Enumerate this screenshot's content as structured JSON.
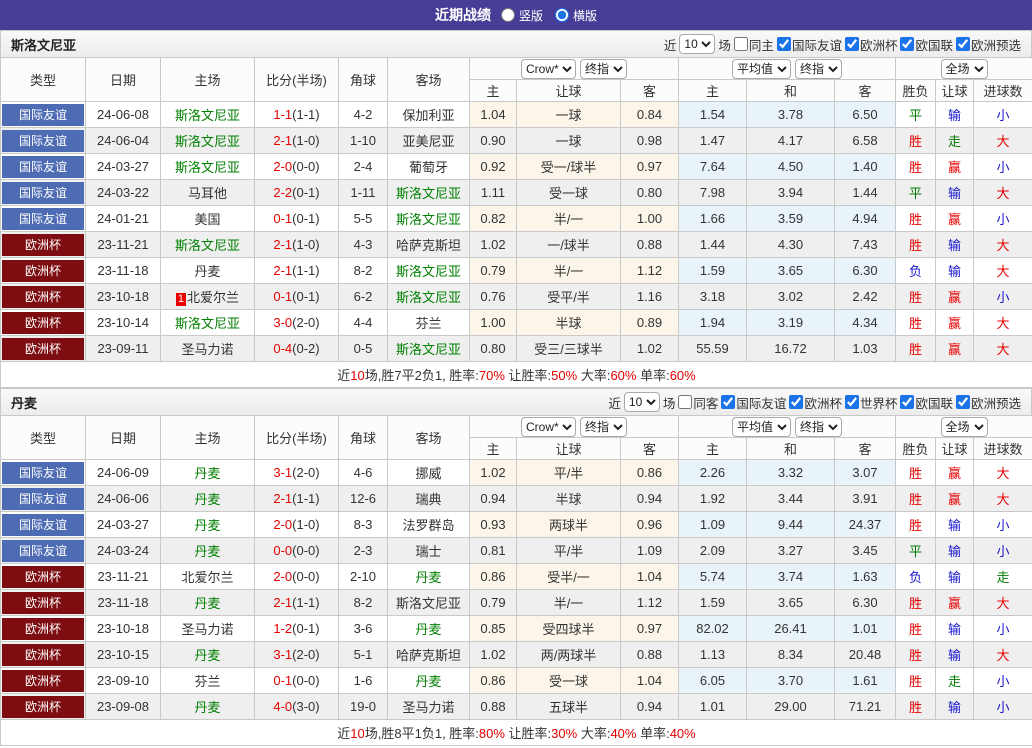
{
  "title_bar": {
    "title": "近期战绩",
    "orientation_options": [
      {
        "label": "竖版",
        "checked": false
      },
      {
        "label": "横版",
        "checked": true
      }
    ]
  },
  "table_head": {
    "left_columns": [
      "类型",
      "日期",
      "主场",
      "比分(半场)",
      "角球",
      "客场"
    ],
    "group1_selects": [
      "Crow*",
      "终指"
    ],
    "group2_selects": [
      "平均值",
      "终指"
    ],
    "group3_selects": [
      "全场"
    ],
    "sub_columns": [
      "主",
      "让球",
      "客",
      "主",
      "和",
      "客",
      "胜负",
      "让球",
      "进球数"
    ]
  },
  "league_colors": {
    "国际友谊": "#4e6cb3",
    "欧洲杯": "#7d0d10"
  },
  "result_colors": {
    "red": "#e60000",
    "blue": "#1515cc",
    "green": "#007a00"
  },
  "score_color": "#e60000",
  "team_highlight_color": "#008000",
  "sections": [
    {
      "team": "斯洛文尼亚",
      "filter": {
        "prefix": "近",
        "count": "10",
        "suffix": "场",
        "same": {
          "label": "同主",
          "checked": false
        },
        "leagues": [
          {
            "label": "国际友谊",
            "checked": true
          },
          {
            "label": "欧洲杯",
            "checked": true
          },
          {
            "label": "欧国联",
            "checked": true
          },
          {
            "label": "欧洲预选",
            "checked": true
          }
        ]
      },
      "rows": [
        {
          "league": "国际友谊",
          "date": "24-06-08",
          "home": "斯洛文尼亚",
          "home_highlight": true,
          "home_badge": "",
          "score": "1-1",
          "half": "(1-1)",
          "corners": "4-2",
          "away": "保加利亚",
          "away_highlight": false,
          "odds": [
            "1.04",
            "一球",
            "0.84",
            "1.54",
            "3.78",
            "6.50"
          ],
          "results": [
            [
              "平",
              "green"
            ],
            [
              "输",
              "blue"
            ],
            [
              "小",
              "blue"
            ]
          ]
        },
        {
          "league": "国际友谊",
          "date": "24-06-04",
          "home": "斯洛文尼亚",
          "home_highlight": true,
          "home_badge": "",
          "score": "2-1",
          "half": "(1-0)",
          "corners": "1-10",
          "away": "亚美尼亚",
          "away_highlight": false,
          "odds": [
            "0.90",
            "一球",
            "0.98",
            "1.47",
            "4.17",
            "6.58"
          ],
          "results": [
            [
              "胜",
              "red"
            ],
            [
              "走",
              "green"
            ],
            [
              "大",
              "red"
            ]
          ]
        },
        {
          "league": "国际友谊",
          "date": "24-03-27",
          "home": "斯洛文尼亚",
          "home_highlight": true,
          "home_badge": "",
          "score": "2-0",
          "half": "(0-0)",
          "corners": "2-4",
          "away": "葡萄牙",
          "away_highlight": false,
          "odds": [
            "0.92",
            "受一/球半",
            "0.97",
            "7.64",
            "4.50",
            "1.40"
          ],
          "results": [
            [
              "胜",
              "red"
            ],
            [
              "赢",
              "red"
            ],
            [
              "小",
              "blue"
            ]
          ]
        },
        {
          "league": "国际友谊",
          "date": "24-03-22",
          "home": "马耳他",
          "home_highlight": false,
          "home_badge": "",
          "score": "2-2",
          "half": "(0-1)",
          "corners": "1-11",
          "away": "斯洛文尼亚",
          "away_highlight": true,
          "odds": [
            "1.11",
            "受一球",
            "0.80",
            "7.98",
            "3.94",
            "1.44"
          ],
          "results": [
            [
              "平",
              "green"
            ],
            [
              "输",
              "blue"
            ],
            [
              "大",
              "red"
            ]
          ]
        },
        {
          "league": "国际友谊",
          "date": "24-01-21",
          "home": "美国",
          "home_highlight": false,
          "home_badge": "",
          "score": "0-1",
          "half": "(0-1)",
          "corners": "5-5",
          "away": "斯洛文尼亚",
          "away_highlight": true,
          "odds": [
            "0.82",
            "半/一",
            "1.00",
            "1.66",
            "3.59",
            "4.94"
          ],
          "results": [
            [
              "胜",
              "red"
            ],
            [
              "赢",
              "red"
            ],
            [
              "小",
              "blue"
            ]
          ]
        },
        {
          "league": "欧洲杯",
          "date": "23-11-21",
          "home": "斯洛文尼亚",
          "home_highlight": true,
          "home_badge": "",
          "score": "2-1",
          "half": "(1-0)",
          "corners": "4-3",
          "away": "哈萨克斯坦",
          "away_highlight": false,
          "odds": [
            "1.02",
            "一/球半",
            "0.88",
            "1.44",
            "4.30",
            "7.43"
          ],
          "results": [
            [
              "胜",
              "red"
            ],
            [
              "输",
              "blue"
            ],
            [
              "大",
              "red"
            ]
          ]
        },
        {
          "league": "欧洲杯",
          "date": "23-11-18",
          "home": "丹麦",
          "home_highlight": false,
          "home_badge": "",
          "score": "2-1",
          "half": "(1-1)",
          "corners": "8-2",
          "away": "斯洛文尼亚",
          "away_highlight": true,
          "odds": [
            "0.79",
            "半/一",
            "1.12",
            "1.59",
            "3.65",
            "6.30"
          ],
          "results": [
            [
              "负",
              "blue"
            ],
            [
              "输",
              "blue"
            ],
            [
              "大",
              "red"
            ]
          ]
        },
        {
          "league": "欧洲杯",
          "date": "23-10-18",
          "home": "北爱尔兰",
          "home_highlight": false,
          "home_badge": "1",
          "score": "0-1",
          "half": "(0-1)",
          "corners": "6-2",
          "away": "斯洛文尼亚",
          "away_highlight": true,
          "odds": [
            "0.76",
            "受平/半",
            "1.16",
            "3.18",
            "3.02",
            "2.42"
          ],
          "results": [
            [
              "胜",
              "red"
            ],
            [
              "赢",
              "red"
            ],
            [
              "小",
              "blue"
            ]
          ]
        },
        {
          "league": "欧洲杯",
          "date": "23-10-14",
          "home": "斯洛文尼亚",
          "home_highlight": true,
          "home_badge": "",
          "score": "3-0",
          "half": "(2-0)",
          "corners": "4-4",
          "away": "芬兰",
          "away_highlight": false,
          "odds": [
            "1.00",
            "半球",
            "0.89",
            "1.94",
            "3.19",
            "4.34"
          ],
          "results": [
            [
              "胜",
              "red"
            ],
            [
              "赢",
              "red"
            ],
            [
              "大",
              "red"
            ]
          ]
        },
        {
          "league": "欧洲杯",
          "date": "23-09-11",
          "home": "圣马力诺",
          "home_highlight": false,
          "home_badge": "",
          "score": "0-4",
          "half": "(0-2)",
          "corners": "0-5",
          "away": "斯洛文尼亚",
          "away_highlight": true,
          "odds": [
            "0.80",
            "受三/三球半",
            "1.02",
            "55.59",
            "16.72",
            "1.03"
          ],
          "results": [
            [
              "胜",
              "red"
            ],
            [
              "赢",
              "red"
            ],
            [
              "大",
              "red"
            ]
          ]
        }
      ],
      "summary": [
        [
          "近",
          false
        ],
        [
          "10",
          true
        ],
        [
          "场,胜7平2负1, 胜率:",
          false
        ],
        [
          "70%",
          true
        ],
        [
          " 让胜率:",
          false
        ],
        [
          "50%",
          true
        ],
        [
          " 大率:",
          false
        ],
        [
          "60%",
          true
        ],
        [
          " 单率:",
          false
        ],
        [
          "60%",
          true
        ]
      ]
    },
    {
      "team": "丹麦",
      "filter": {
        "prefix": "近",
        "count": "10",
        "suffix": "场",
        "same": {
          "label": "同客",
          "checked": false
        },
        "leagues": [
          {
            "label": "国际友谊",
            "checked": true
          },
          {
            "label": "欧洲杯",
            "checked": true
          },
          {
            "label": "世界杯",
            "checked": true
          },
          {
            "label": "欧国联",
            "checked": true
          },
          {
            "label": "欧洲预选",
            "checked": true
          }
        ]
      },
      "rows": [
        {
          "league": "国际友谊",
          "date": "24-06-09",
          "home": "丹麦",
          "home_highlight": true,
          "home_badge": "",
          "score": "3-1",
          "half": "(2-0)",
          "corners": "4-6",
          "away": "挪威",
          "away_highlight": false,
          "odds": [
            "1.02",
            "平/半",
            "0.86",
            "2.26",
            "3.32",
            "3.07"
          ],
          "results": [
            [
              "胜",
              "red"
            ],
            [
              "赢",
              "red"
            ],
            [
              "大",
              "red"
            ]
          ]
        },
        {
          "league": "国际友谊",
          "date": "24-06-06",
          "home": "丹麦",
          "home_highlight": true,
          "home_badge": "",
          "score": "2-1",
          "half": "(1-1)",
          "corners": "12-6",
          "away": "瑞典",
          "away_highlight": false,
          "odds": [
            "0.94",
            "半球",
            "0.94",
            "1.92",
            "3.44",
            "3.91"
          ],
          "results": [
            [
              "胜",
              "red"
            ],
            [
              "赢",
              "red"
            ],
            [
              "大",
              "red"
            ]
          ]
        },
        {
          "league": "国际友谊",
          "date": "24-03-27",
          "home": "丹麦",
          "home_highlight": true,
          "home_badge": "",
          "score": "2-0",
          "half": "(1-0)",
          "corners": "8-3",
          "away": "法罗群岛",
          "away_highlight": false,
          "odds": [
            "0.93",
            "两球半",
            "0.96",
            "1.09",
            "9.44",
            "24.37"
          ],
          "results": [
            [
              "胜",
              "red"
            ],
            [
              "输",
              "blue"
            ],
            [
              "小",
              "blue"
            ]
          ]
        },
        {
          "league": "国际友谊",
          "date": "24-03-24",
          "home": "丹麦",
          "home_highlight": true,
          "home_badge": "",
          "score": "0-0",
          "half": "(0-0)",
          "corners": "2-3",
          "away": "瑞士",
          "away_highlight": false,
          "odds": [
            "0.81",
            "平/半",
            "1.09",
            "2.09",
            "3.27",
            "3.45"
          ],
          "results": [
            [
              "平",
              "green"
            ],
            [
              "输",
              "blue"
            ],
            [
              "小",
              "blue"
            ]
          ]
        },
        {
          "league": "欧洲杯",
          "date": "23-11-21",
          "home": "北爱尔兰",
          "home_highlight": false,
          "home_badge": "",
          "score": "2-0",
          "half": "(0-0)",
          "corners": "2-10",
          "away": "丹麦",
          "away_highlight": true,
          "odds": [
            "0.86",
            "受半/一",
            "1.04",
            "5.74",
            "3.74",
            "1.63"
          ],
          "results": [
            [
              "负",
              "blue"
            ],
            [
              "输",
              "blue"
            ],
            [
              "走",
              "green"
            ]
          ]
        },
        {
          "league": "欧洲杯",
          "date": "23-11-18",
          "home": "丹麦",
          "home_highlight": true,
          "home_badge": "",
          "score": "2-1",
          "half": "(1-1)",
          "corners": "8-2",
          "away": "斯洛文尼亚",
          "away_highlight": false,
          "odds": [
            "0.79",
            "半/一",
            "1.12",
            "1.59",
            "3.65",
            "6.30"
          ],
          "results": [
            [
              "胜",
              "red"
            ],
            [
              "赢",
              "red"
            ],
            [
              "大",
              "red"
            ]
          ]
        },
        {
          "league": "欧洲杯",
          "date": "23-10-18",
          "home": "圣马力诺",
          "home_highlight": false,
          "home_badge": "",
          "score": "1-2",
          "half": "(0-1)",
          "corners": "3-6",
          "away": "丹麦",
          "away_highlight": true,
          "odds": [
            "0.85",
            "受四球半",
            "0.97",
            "82.02",
            "26.41",
            "1.01"
          ],
          "results": [
            [
              "胜",
              "red"
            ],
            [
              "输",
              "blue"
            ],
            [
              "小",
              "blue"
            ]
          ]
        },
        {
          "league": "欧洲杯",
          "date": "23-10-15",
          "home": "丹麦",
          "home_highlight": true,
          "home_badge": "",
          "score": "3-1",
          "half": "(2-0)",
          "corners": "5-1",
          "away": "哈萨克斯坦",
          "away_highlight": false,
          "odds": [
            "1.02",
            "两/两球半",
            "0.88",
            "1.13",
            "8.34",
            "20.48"
          ],
          "results": [
            [
              "胜",
              "red"
            ],
            [
              "输",
              "blue"
            ],
            [
              "大",
              "red"
            ]
          ]
        },
        {
          "league": "欧洲杯",
          "date": "23-09-10",
          "home": "芬兰",
          "home_highlight": false,
          "home_badge": "",
          "score": "0-1",
          "half": "(0-0)",
          "corners": "1-6",
          "away": "丹麦",
          "away_highlight": true,
          "odds": [
            "0.86",
            "受一球",
            "1.04",
            "6.05",
            "3.70",
            "1.61"
          ],
          "results": [
            [
              "胜",
              "red"
            ],
            [
              "走",
              "green"
            ],
            [
              "小",
              "blue"
            ]
          ]
        },
        {
          "league": "欧洲杯",
          "date": "23-09-08",
          "home": "丹麦",
          "home_highlight": true,
          "home_badge": "",
          "score": "4-0",
          "half": "(3-0)",
          "corners": "19-0",
          "away": "圣马力诺",
          "away_highlight": false,
          "odds": [
            "0.88",
            "五球半",
            "0.94",
            "1.01",
            "29.00",
            "71.21"
          ],
          "results": [
            [
              "胜",
              "red"
            ],
            [
              "输",
              "blue"
            ],
            [
              "小",
              "blue"
            ]
          ]
        }
      ],
      "summary": [
        [
          "近",
          false
        ],
        [
          "10",
          true
        ],
        [
          "场,胜8平1负1, 胜率:",
          false
        ],
        [
          "80%",
          true
        ],
        [
          " 让胜率:",
          false
        ],
        [
          "30%",
          true
        ],
        [
          " 大率:",
          false
        ],
        [
          "40%",
          true
        ],
        [
          " 单率:",
          false
        ],
        [
          "40%",
          true
        ]
      ]
    }
  ]
}
